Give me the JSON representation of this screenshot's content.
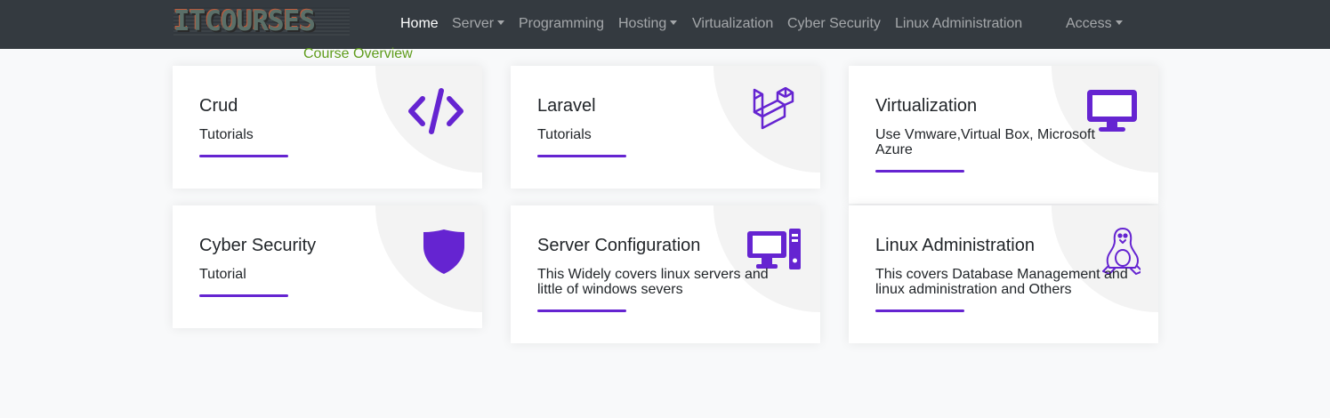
{
  "navbar": {
    "brand": "ITCOURSES",
    "items": [
      {
        "label": "Home",
        "active": true,
        "dropdown": false
      },
      {
        "label": "Server",
        "active": false,
        "dropdown": true
      },
      {
        "label": "Programming",
        "active": false,
        "dropdown": false
      },
      {
        "label": "Hosting",
        "active": false,
        "dropdown": true
      },
      {
        "label": "Virtualization",
        "active": false,
        "dropdown": false
      },
      {
        "label": "Cyber Security",
        "active": false,
        "dropdown": false
      },
      {
        "label": "Linux Administration",
        "active": false,
        "dropdown": false
      }
    ],
    "access": {
      "label": "Access",
      "dropdown": true
    }
  },
  "course_overview": "Course Overview",
  "accent_color": "#6524d1",
  "cards": [
    {
      "title": "Crud",
      "desc": "Tutorials",
      "icon": "code-icon"
    },
    {
      "title": "Laravel",
      "desc": "Tutorials",
      "icon": "laravel-icon"
    },
    {
      "title": "Virtualization",
      "desc": "Use Vmware,Virtual Box, Microsoft Azure",
      "icon": "desktop-icon"
    },
    {
      "title": "Cyber Security",
      "desc": "Tutorial",
      "icon": "shield-icon"
    },
    {
      "title": "Server Configuration",
      "desc": "This Widely covers linux servers and little of windows severs",
      "icon": "computer-tower-icon"
    },
    {
      "title": "Linux Administration",
      "desc": "This covers Database Management and linux administration and Others",
      "icon": "linux-icon"
    }
  ]
}
